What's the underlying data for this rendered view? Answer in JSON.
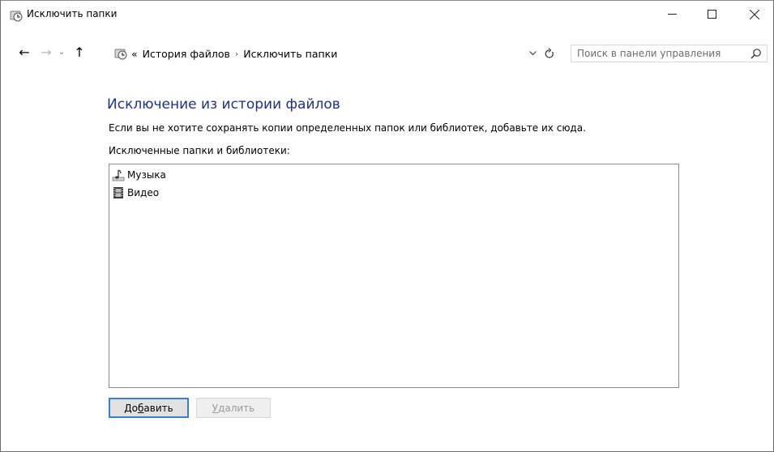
{
  "window": {
    "title": "Исключить папки",
    "icon": "file-history-icon",
    "controls": {
      "minimize": "—",
      "maximize": "☐",
      "close": "✕"
    }
  },
  "nav": {
    "back": "←",
    "forward": "→",
    "recent": "⌄",
    "up": "↑",
    "breadcrumb_overflow": "«",
    "breadcrumbs": [
      "История файлов",
      "Исключить папки"
    ],
    "separator": "›",
    "search_placeholder": "Поиск в панели управления"
  },
  "content": {
    "heading": "Исключение из истории файлов",
    "description": "Если вы не хотите сохранять копии определенных папок или библиотек, добавьте их сюда.",
    "list_label": "Исключенные папки и библиотеки:",
    "items": [
      {
        "label": "Музыка",
        "icon": "music-library-icon"
      },
      {
        "label": "Видео",
        "icon": "video-library-icon"
      }
    ]
  },
  "buttons": {
    "add": {
      "before": "До",
      "accel": "б",
      "after": "авить"
    },
    "remove": {
      "before": "",
      "accel": "У",
      "after": "далить",
      "enabled": false
    }
  },
  "colors": {
    "heading": "#1e3287",
    "focus_border": "#3c7ed2"
  }
}
